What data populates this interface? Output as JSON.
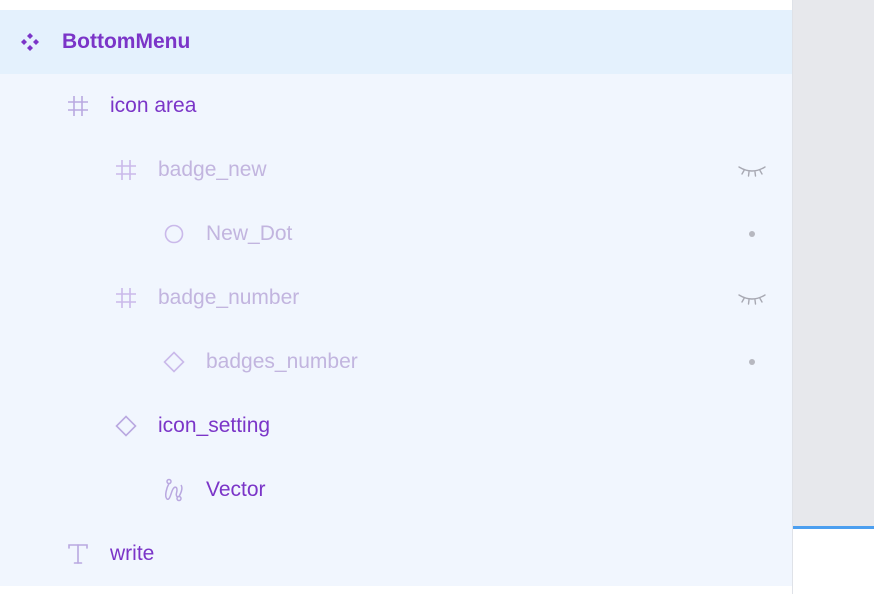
{
  "colors": {
    "active_text": "#7b35c8",
    "hidden_text": "#c2b5df",
    "active_icon": "#b9a8e0",
    "hidden_icon": "#cab9ea",
    "eye": "#a8a9b3",
    "dot": "#b7b8c0",
    "panel_bg": "#f1f6fe",
    "selected_bg": "#e4f1fd"
  },
  "layers": [
    {
      "name": "BottomMenu",
      "icon": "component-icon",
      "visible": true,
      "selected": true
    },
    {
      "name": "icon area",
      "icon": "frame-icon",
      "visible": true,
      "selected": false
    },
    {
      "name": "badge_new",
      "icon": "frame-icon",
      "visible": false,
      "selected": false,
      "hidden_indicator": "eye-closed-icon"
    },
    {
      "name": "New_Dot",
      "icon": "ellipse-icon",
      "visible": false,
      "selected": false,
      "hidden_indicator": "dot-icon"
    },
    {
      "name": "badge_number",
      "icon": "frame-icon",
      "visible": false,
      "selected": false,
      "hidden_indicator": "eye-closed-icon"
    },
    {
      "name": "badges_number",
      "icon": "instance-icon",
      "visible": false,
      "selected": false,
      "hidden_indicator": "dot-icon"
    },
    {
      "name": "icon_setting",
      "icon": "instance-icon",
      "visible": true,
      "selected": false
    },
    {
      "name": "Vector",
      "icon": "vector-icon",
      "visible": true,
      "selected": false
    },
    {
      "name": "write",
      "icon": "text-icon",
      "visible": true,
      "selected": false
    }
  ]
}
